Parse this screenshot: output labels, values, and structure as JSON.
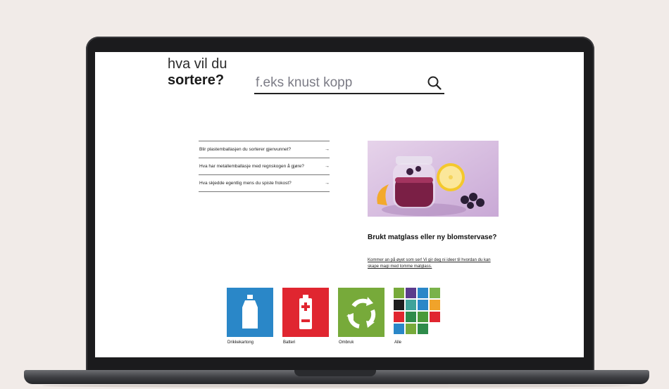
{
  "heading": {
    "line1": "hva vil du",
    "line2": "sortere?"
  },
  "search": {
    "placeholder": "f.eks knust kopp",
    "value": ""
  },
  "questions": [
    "Blir plastemballasjen du sorterer gjenvunnet?",
    "Hva har metallemballasje med regnskogen å gjøre?",
    "Hva skjedde egentlig mens du spiste frokost?"
  ],
  "question_arrow": "→",
  "article": {
    "title": "Brukt matglass eller ny blomstervase?",
    "text": "Kommer an på øyet som ser! Vi gir deg ni ideer til hvordan du kan skape magi med tomme matglass."
  },
  "categories": [
    {
      "label": "Drikkekartong",
      "color": "#2a87c8",
      "icon": "carton-icon"
    },
    {
      "label": "Batteri",
      "color": "#e02630",
      "icon": "battery-icon"
    },
    {
      "label": "Ombruk",
      "color": "#77aa3a",
      "icon": "reuse-icon"
    },
    {
      "label": "Alle",
      "color": "#ffffff",
      "icon": "all-categories-grid-icon"
    }
  ],
  "colors": {
    "page_bg": "#f1ebe8",
    "bezel": "#1b1b1d",
    "carton": "#2a87c8",
    "battery": "#e02630",
    "reuse": "#77aa3a"
  }
}
